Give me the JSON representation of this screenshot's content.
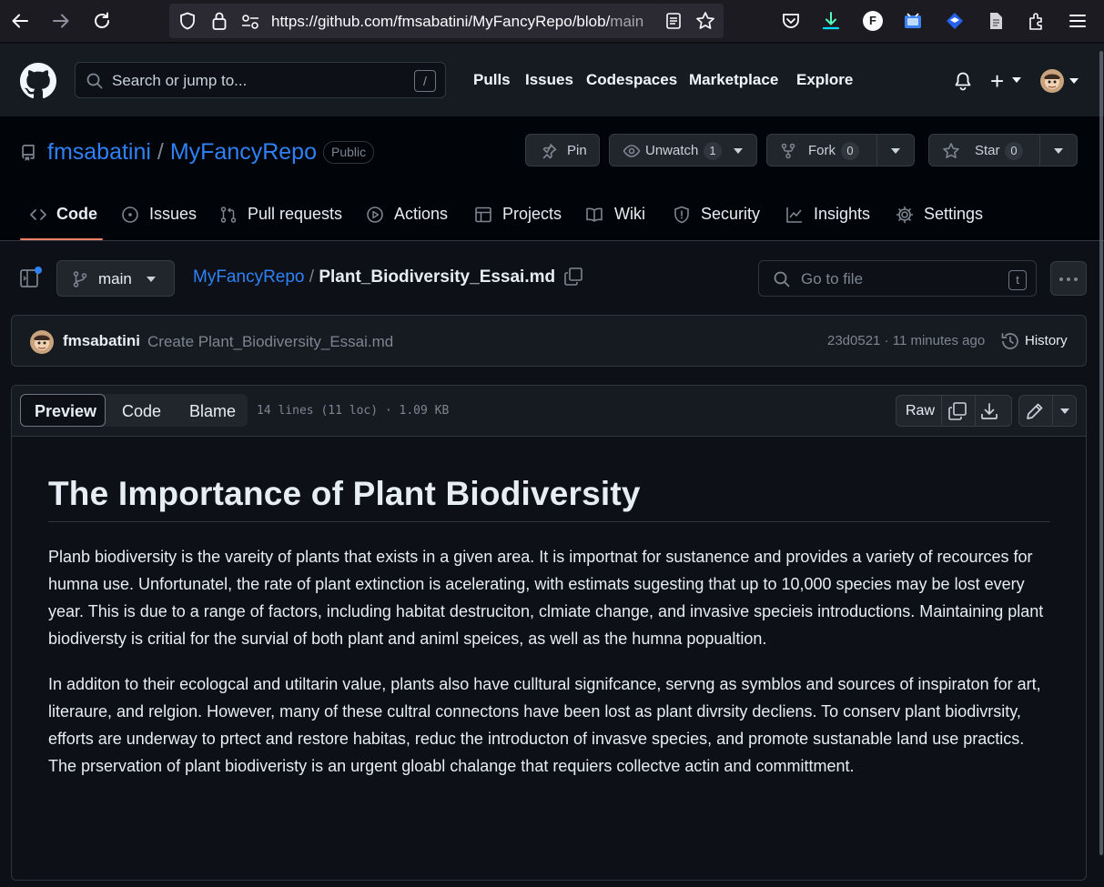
{
  "browser": {
    "url_main": "https://github.com/fmsabatini/MyFancyRepo/blob/",
    "url_tail": "main",
    "profile_initial": "F"
  },
  "header": {
    "search_placeholder": "Search or jump to...",
    "search_shortcut": "/",
    "nav": [
      "Pulls",
      "Issues",
      "Codespaces",
      "Marketplace",
      "Explore"
    ],
    "new_symbol": "+"
  },
  "repo": {
    "owner": "fmsabatini",
    "separator": "/",
    "name": "MyFancyRepo",
    "visibility": "Public",
    "pin_label": "Pin",
    "unwatch_label": "Unwatch",
    "watch_count": "1",
    "fork_label": "Fork",
    "fork_count": "0",
    "star_label": "Star",
    "star_count": "0"
  },
  "tabs": [
    {
      "label": "Code",
      "icon": "code-icon",
      "selected": true
    },
    {
      "label": "Issues",
      "icon": "issue-opened-icon"
    },
    {
      "label": "Pull requests",
      "icon": "git-pull-request-icon"
    },
    {
      "label": "Actions",
      "icon": "play-icon"
    },
    {
      "label": "Projects",
      "icon": "table-icon"
    },
    {
      "label": "Wiki",
      "icon": "book-icon"
    },
    {
      "label": "Security",
      "icon": "shield-icon"
    },
    {
      "label": "Insights",
      "icon": "graph-icon"
    },
    {
      "label": "Settings",
      "icon": "gear-icon"
    }
  ],
  "breadcrumb": {
    "branch": "main",
    "repo": "MyFancyRepo",
    "separator": "/",
    "file": "Plant_Biodiversity_Essai.md",
    "goto_placeholder": "Go to file",
    "goto_shortcut": "t"
  },
  "commit": {
    "author": "fmsabatini",
    "message": "Create Plant_Biodiversity_Essai.md",
    "meta": "23d0521 · 11 minutes ago",
    "history_label": "History"
  },
  "file_view": {
    "modes": [
      "Preview",
      "Code",
      "Blame"
    ],
    "active_mode": "Preview",
    "info": "14 lines (11 loc) · 1.09 KB",
    "raw_label": "Raw"
  },
  "content": {
    "heading": "The Importance of Plant Biodiversity",
    "paragraphs": [
      "Planb biodiversity is the vareity of plants that exists in a given area. It is importnat for sustanence and provides a variety of recources for humna use. Unfortunatel, the rate of plant extinction is acelerating, with estimats sugesting that up to 10,000 species may be lost every year. This is due to a range of factors, including habitat destruciton, clmiate change, and invasive specieis introductions. Maintaining plant biodiversty is critial for the survial of both plant and animl speices, as well as the humna popualtion.",
      "In additon to their ecologcal and utiltarin value, plants also have culltural signifcance, servng as symblos and sources of inspiraton for art, literaure, and relgion. However, many of these cultral connectons have been lost as plant divrsity decliens. To conserv plant biodivrsity, efforts are underway to prtect and restore habitas, reduc the introducton of invasve species, and promote sustanable land use practics. The prservation of plant biodiveristy is an urgent gloabl chalange that requiers collectve actin and committment."
    ]
  },
  "colors": {
    "accent_link": "#2f81f7",
    "tab_underline": "#f78166",
    "background": "#0d1117",
    "text": "#e6edf3",
    "muted": "#7d8590"
  }
}
